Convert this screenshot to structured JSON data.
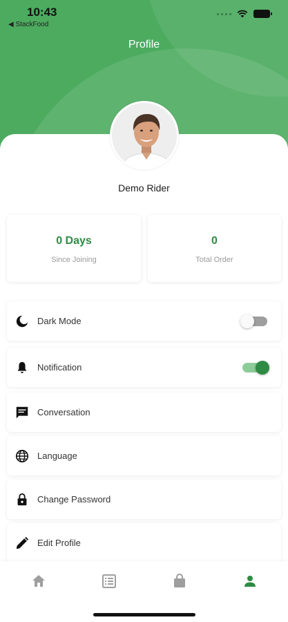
{
  "status_bar": {
    "time": "10:43",
    "back_app": "◀ StackFood"
  },
  "header": {
    "title": "Profile"
  },
  "profile": {
    "name": "Demo Rider"
  },
  "stats": [
    {
      "value": "0 Days",
      "caption": "Since Joining"
    },
    {
      "value": "0",
      "caption": "Total Order"
    }
  ],
  "menu": [
    {
      "label": "Dark Mode",
      "icon": "moon-icon",
      "toggle": "off"
    },
    {
      "label": "Notification",
      "icon": "bell-icon",
      "toggle": "on"
    },
    {
      "label": "Conversation",
      "icon": "chat-icon"
    },
    {
      "label": "Language",
      "icon": "globe-icon"
    },
    {
      "label": "Change Password",
      "icon": "lock-icon"
    },
    {
      "label": "Edit Profile",
      "icon": "pencil-icon"
    }
  ],
  "bottom_nav": [
    {
      "icon": "home-icon",
      "active": false
    },
    {
      "icon": "list-icon",
      "active": false
    },
    {
      "icon": "bag-icon",
      "active": false
    },
    {
      "icon": "person-icon",
      "active": true
    }
  ],
  "colors": {
    "primary": "#4CAB5F",
    "accent_text": "#2E8B43",
    "inactive_icon": "#9e9e9e"
  }
}
